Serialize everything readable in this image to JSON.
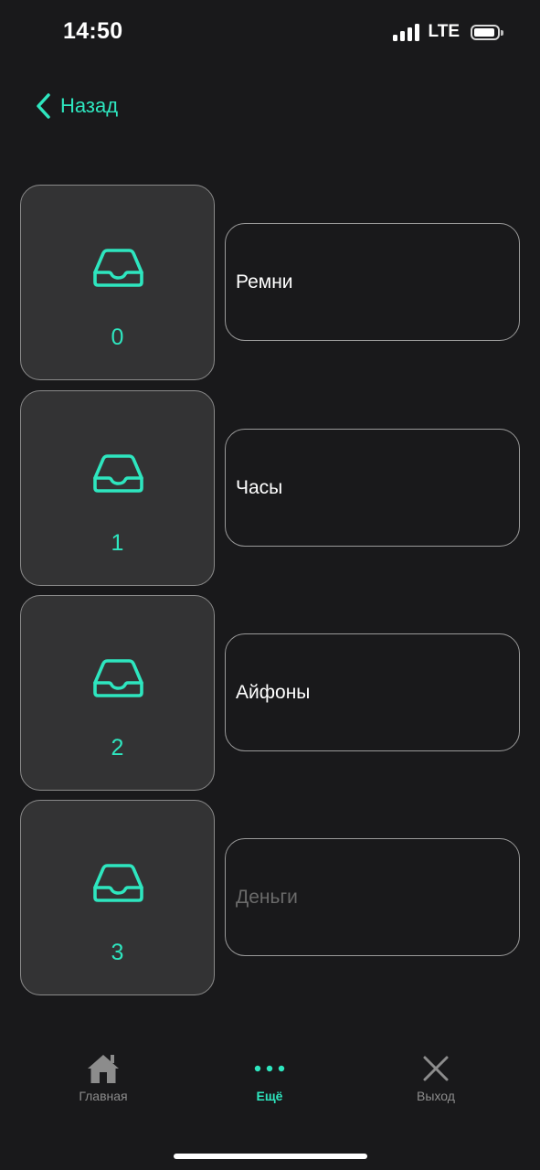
{
  "status_bar": {
    "time": "14:50",
    "network": "LTE"
  },
  "nav": {
    "back_label": "Назад",
    "back_icon": "chevron-left-icon"
  },
  "colors": {
    "accent": "#2ee6bf",
    "background": "#19191b",
    "tile_background": "#333334",
    "muted": "#8c8c8c"
  },
  "cells": [
    {
      "number": "0",
      "name": "Ремни",
      "icon": "inbox-tray-icon",
      "placeholder": false
    },
    {
      "number": "1",
      "name": "Часы",
      "icon": "inbox-tray-icon",
      "placeholder": false
    },
    {
      "number": "2",
      "name": "Айфоны",
      "icon": "inbox-tray-icon",
      "placeholder": false
    },
    {
      "number": "3",
      "name": "Деньги",
      "icon": "inbox-tray-icon",
      "placeholder": true
    }
  ],
  "tab_bar": {
    "tabs": [
      {
        "label": "Главная",
        "icon": "home-icon",
        "active": false
      },
      {
        "label": "Ещё",
        "icon": "more-dots-icon",
        "active": true
      },
      {
        "label": "Выход",
        "icon": "close-icon",
        "active": false
      }
    ]
  }
}
